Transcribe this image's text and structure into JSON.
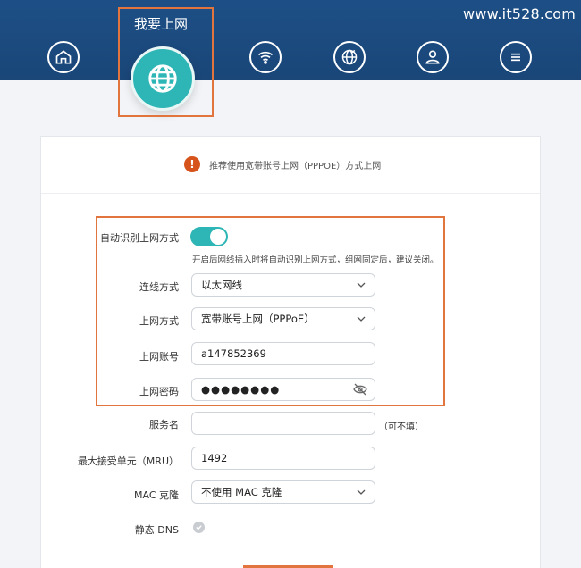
{
  "watermark": "www.it528.com",
  "nav": {
    "active_label": "我要上网",
    "icons": [
      "home-icon",
      "globe-icon",
      "wifi-icon",
      "devices-icon",
      "user-icon",
      "menu-icon"
    ]
  },
  "notice": {
    "icon": "!",
    "text": "推荐使用宽带账号上网（PPPOE）方式上网"
  },
  "form": {
    "auto_detect": {
      "label": "自动识别上网方式",
      "enabled": true,
      "hint": "开启后网线插入时将自动识别上网方式，组网固定后，建议关闭。"
    },
    "connection_type": {
      "label": "连线方式",
      "value": "以太网线"
    },
    "internet_mode": {
      "label": "上网方式",
      "value": "宽带账号上网（PPPoE）"
    },
    "account": {
      "label": "上网账号",
      "value": "a147852369"
    },
    "password": {
      "label": "上网密码",
      "value": "●●●●●●●●"
    },
    "service_name": {
      "label": "服务名",
      "value": "",
      "suffix": "（可不填）"
    },
    "mru": {
      "label": "最大接受单元（MRU）",
      "value": "1492"
    },
    "mac_clone": {
      "label": "MAC 克隆",
      "value": "不使用 MAC 克隆"
    },
    "static_dns": {
      "label": "静态 DNS"
    }
  },
  "colors": {
    "header": "#1a4678",
    "accent": "#2db6b5",
    "highlight": "#e2743e",
    "warning": "#d6541c"
  }
}
